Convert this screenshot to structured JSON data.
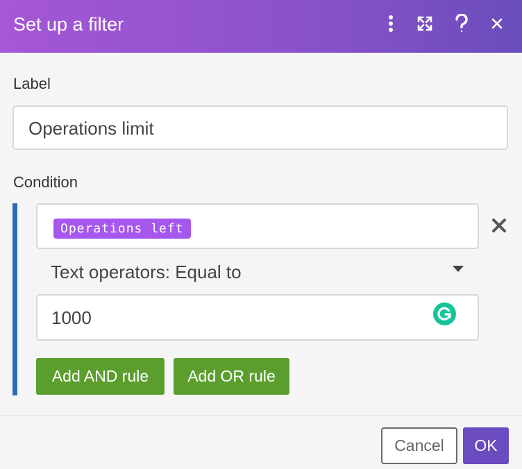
{
  "dialog": {
    "title": "Set up a filter",
    "header_icons": [
      "more-vertical-icon",
      "expand-icon",
      "help-icon",
      "close-icon"
    ],
    "accent_color": "#8c52c9"
  },
  "form": {
    "label_heading": "Label",
    "label_value": "Operations limit",
    "condition_heading": "Condition",
    "condition": {
      "field_token": "Operations left",
      "operator": "Text operators: Equal to",
      "value": "1000"
    },
    "add_and_label": "Add AND rule",
    "add_or_label": "Add OR rule"
  },
  "footer": {
    "cancel_label": "Cancel",
    "ok_label": "OK"
  },
  "colors": {
    "token": "#a657ee",
    "green_button": "#5b9e2d",
    "ok_button": "#6a4cc0",
    "condition_bar": "#2a6fb5",
    "grammarly": "#15c39a"
  }
}
